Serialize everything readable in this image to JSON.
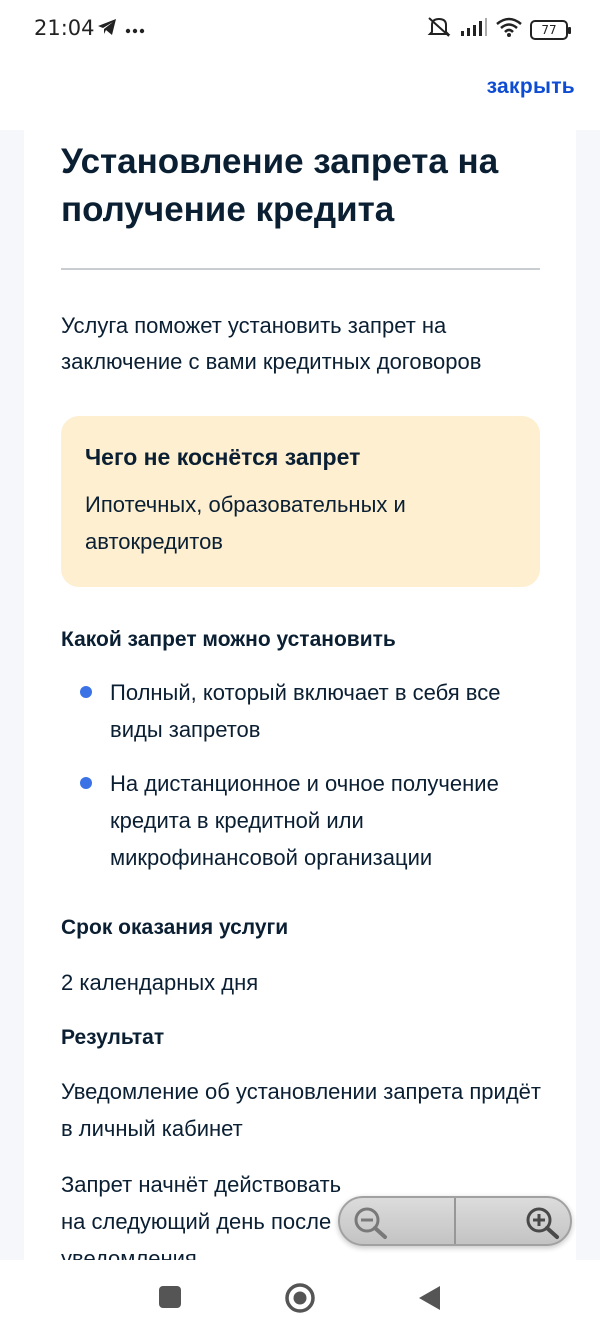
{
  "status_bar": {
    "time": "21:04",
    "battery": "77",
    "icons": [
      "telegram-icon",
      "more-icon",
      "mute-icon",
      "signal-icon",
      "wifi-icon",
      "battery-icon"
    ]
  },
  "header": {
    "close_label": "закрыть"
  },
  "page": {
    "title": "Установление запрета на получение кредита",
    "lead": "Услуга поможет установить запрет на заключение с вами кредитных договоров",
    "note": {
      "title": "Чего не коснётся запрет",
      "text": "Ипотечных, образовательных и автокредитов"
    },
    "ban_types": {
      "title": "Какой запрет можно установить",
      "items": [
        "Полный, который включает в себя все виды запретов",
        "На дистанционное и очное получение кредита в кредитной или микрофинансовой организации"
      ]
    },
    "term": {
      "title": "Срок оказания услуги",
      "value": "2 календарных дня"
    },
    "result": {
      "title": "Результат",
      "text1": "Уведомление об установлении запрета придёт в личный кабинет",
      "text2": "Запрет начнёт действовать на следующий день после уведомления"
    }
  },
  "colors": {
    "accent": "#0d4cd3",
    "note_bg": "#fdefd0",
    "bullet": "#3b73e6",
    "text": "#0b1f33"
  }
}
